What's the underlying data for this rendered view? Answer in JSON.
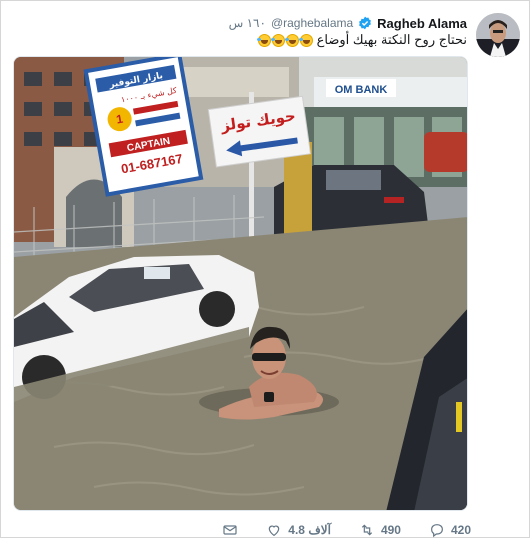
{
  "user": {
    "name": "Ragheb Alama",
    "handle": "@raghebalama",
    "time": "١٦٠ س"
  },
  "tweet": {
    "text": "نحتاج روح النكتة بهيك أوضاع",
    "emoji_count": 4
  },
  "media": {
    "signs": {
      "store_1": "بازار التوفير",
      "store_2": "كل شيء بـ ١٠٠٠",
      "captain": "CAPTAIN",
      "phone": "01-687167",
      "store_3": "حويك تولز",
      "bank": "OM BANK"
    }
  },
  "actions": {
    "reply_count": "420",
    "retweet_count": "490",
    "like_count": "4.8 آلاف",
    "dm_label": ""
  },
  "colors": {
    "verified": "#1da1f2",
    "muted": "#657786",
    "water": "#8b8674"
  }
}
